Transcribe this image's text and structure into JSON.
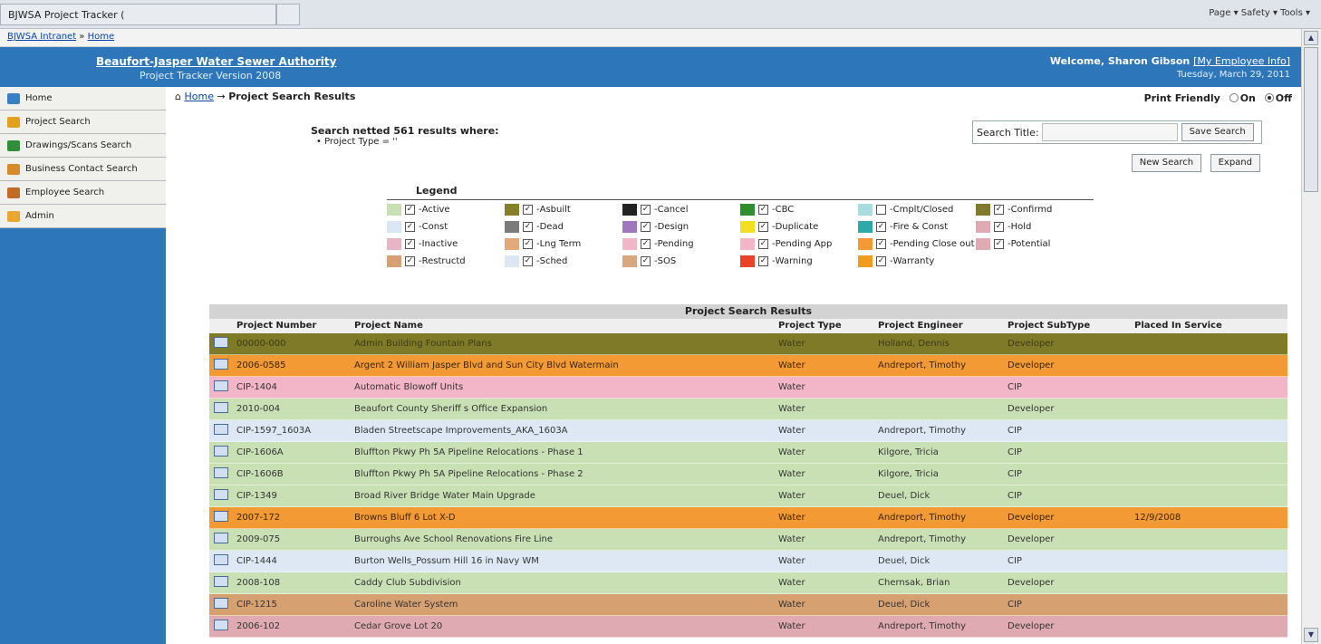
{
  "browser": {
    "tab_title": "BJWSA Project Tracker (",
    "command_bar": "Page ▾   Safety ▾   Tools ▾"
  },
  "favorites": {
    "intranet": "BJWSA Intranet",
    "home": "Home"
  },
  "header": {
    "org_name": "Beaufort-Jasper Water Sewer Authority",
    "version": "Project Tracker Version 2008",
    "welcome": "Welcome, Sharon Gibson",
    "my_info": "[My Employee Info]",
    "date": "Tuesday, March 29, 2011"
  },
  "sidebar": {
    "items": [
      {
        "label": "Home",
        "color": "#3a7fc4"
      },
      {
        "label": "Project Search",
        "color": "#e0a020"
      },
      {
        "label": "Drawings/Scans Search",
        "color": "#2f8f3a"
      },
      {
        "label": "Business Contact Search",
        "color": "#d58b2a"
      },
      {
        "label": "Employee Search",
        "color": "#c46a28"
      },
      {
        "label": "Admin",
        "color": "#e8a830"
      }
    ]
  },
  "breadcrumb": {
    "home": "Home",
    "current": "Project Search Results"
  },
  "print_friendly": {
    "label": "Print Friendly",
    "on": "On",
    "off": "Off",
    "selected": "Off"
  },
  "summary": {
    "text": "Search netted 561 results where:",
    "criterion": "Project Type = ''"
  },
  "search": {
    "label": "Search Title:",
    "save_button": "Save Search",
    "new_button": "New Search",
    "expand_button": "Expand"
  },
  "legend": {
    "title": "Legend",
    "items": [
      {
        "label": "Active",
        "color": "#c8e0b4",
        "checked": true
      },
      {
        "label": "Asbuilt",
        "color": "#857f2c",
        "checked": true
      },
      {
        "label": "Cancel",
        "color": "#222222",
        "checked": true
      },
      {
        "label": "CBC",
        "color": "#2f8f2f",
        "checked": true
      },
      {
        "label": "Cmplt/Closed",
        "color": "#a8dcde",
        "checked": false
      },
      {
        "label": "Confirmd",
        "color": "#807a2c",
        "checked": true
      },
      {
        "label": "Const",
        "color": "#d9e6f4",
        "checked": true
      },
      {
        "label": "Dead",
        "color": "#7b7b7b",
        "checked": true
      },
      {
        "label": "Design",
        "color": "#a275bf",
        "checked": true
      },
      {
        "label": "Duplicate",
        "color": "#f2e020",
        "checked": true
      },
      {
        "label": "Fire & Const",
        "color": "#2ea9a9",
        "checked": true
      },
      {
        "label": "Hold",
        "color": "#e0aab2",
        "checked": true
      },
      {
        "label": "Inactive",
        "color": "#e9b4c4",
        "checked": true
      },
      {
        "label": "Lng Term",
        "color": "#e2a97a",
        "checked": true
      },
      {
        "label": "Pending",
        "color": "#f2b6c8",
        "checked": true
      },
      {
        "label": "Pending App",
        "color": "#f2b6c8",
        "checked": true
      },
      {
        "label": "Pending Close out",
        "color": "#f39a34",
        "checked": true
      },
      {
        "label": "Potential",
        "color": "#e0aab2",
        "checked": true
      },
      {
        "label": "Restructd",
        "color": "#d7a071",
        "checked": true
      },
      {
        "label": "Sched",
        "color": "#dce6f4",
        "checked": true
      },
      {
        "label": "SOS",
        "color": "#d9a77e",
        "checked": true
      },
      {
        "label": "Warning",
        "color": "#e8442a",
        "checked": true
      },
      {
        "label": "Warranty",
        "color": "#f39a20",
        "checked": true
      }
    ]
  },
  "results": {
    "title": "Project Search Results",
    "columns": [
      "Project Number",
      "Project Name",
      "Project Type",
      "Project Engineer",
      "Project SubType",
      "Placed In Service"
    ],
    "rows": [
      {
        "number": "00000-000",
        "name": "Admin Building Fountain Plans",
        "type": "Water",
        "engineer": "Holland, Dennis",
        "subtype": "Developer",
        "placed": "",
        "color": "#7f7a28",
        "text": "#3a3a18"
      },
      {
        "number": "2006-0585",
        "name": "Argent 2 William Jasper Blvd and Sun City Blvd Watermain",
        "type": "Water",
        "engineer": "Andreport, Timothy",
        "subtype": "Developer",
        "placed": "",
        "color": "#f39a34",
        "text": "#3b2508"
      },
      {
        "number": "CIP-1404",
        "name": "Automatic Blowoff Units",
        "type": "Water",
        "engineer": "",
        "subtype": "CIP",
        "placed": "",
        "color": "#f2b6c8",
        "text": "#333"
      },
      {
        "number": "2010-004",
        "name": "Beaufort County Sheriff s Office Expansion",
        "type": "Water",
        "engineer": "",
        "subtype": "Developer",
        "placed": "",
        "color": "#c8e0b4",
        "text": "#333"
      },
      {
        "number": "CIP-1597_1603A",
        "name": "Bladen Streetscape Improvements_AKA_1603A",
        "type": "Water",
        "engineer": "Andreport, Timothy",
        "subtype": "CIP",
        "placed": "",
        "color": "#dde8f4",
        "text": "#333"
      },
      {
        "number": "CIP-1606A",
        "name": "Bluffton Pkwy Ph 5A Pipeline Relocations - Phase 1",
        "type": "Water",
        "engineer": "Kilgore, Tricia",
        "subtype": "CIP",
        "placed": "",
        "color": "#c8e0b4",
        "text": "#333"
      },
      {
        "number": "CIP-1606B",
        "name": "Bluffton Pkwy Ph 5A Pipeline Relocations - Phase 2",
        "type": "Water",
        "engineer": "Kilgore, Tricia",
        "subtype": "CIP",
        "placed": "",
        "color": "#c8e0b4",
        "text": "#333"
      },
      {
        "number": "CIP-1349",
        "name": "Broad River Bridge Water Main Upgrade",
        "type": "Water",
        "engineer": "Deuel, Dick",
        "subtype": "CIP",
        "placed": "",
        "color": "#c8e0b4",
        "text": "#333"
      },
      {
        "number": "2007-172",
        "name": "Browns Bluff 6 Lot X-D",
        "type": "Water",
        "engineer": "Andreport, Timothy",
        "subtype": "Developer",
        "placed": "12/9/2008",
        "color": "#f39a34",
        "text": "#3b2508"
      },
      {
        "number": "2009-075",
        "name": "Burroughs Ave School Renovations Fire Line",
        "type": "Water",
        "engineer": "Andreport, Timothy",
        "subtype": "Developer",
        "placed": "",
        "color": "#c8e0b4",
        "text": "#333"
      },
      {
        "number": "CIP-1444",
        "name": "Burton Wells_Possum Hill 16 in Navy WM",
        "type": "Water",
        "engineer": "Deuel, Dick",
        "subtype": "CIP",
        "placed": "",
        "color": "#dde8f4",
        "text": "#333"
      },
      {
        "number": "2008-108",
        "name": "Caddy Club Subdivision",
        "type": "Water",
        "engineer": "Chernsak, Brian",
        "subtype": "Developer",
        "placed": "",
        "color": "#c8e0b4",
        "text": "#333"
      },
      {
        "number": "CIP-1215",
        "name": "Caroline Water System",
        "type": "Water",
        "engineer": "Deuel, Dick",
        "subtype": "CIP",
        "placed": "",
        "color": "#d7a071",
        "text": "#333"
      },
      {
        "number": "2006-102",
        "name": "Cedar Grove Lot 20",
        "type": "Water",
        "engineer": "Andreport, Timothy",
        "subtype": "Developer",
        "placed": "",
        "color": "#e0aab2",
        "text": "#333"
      }
    ]
  }
}
